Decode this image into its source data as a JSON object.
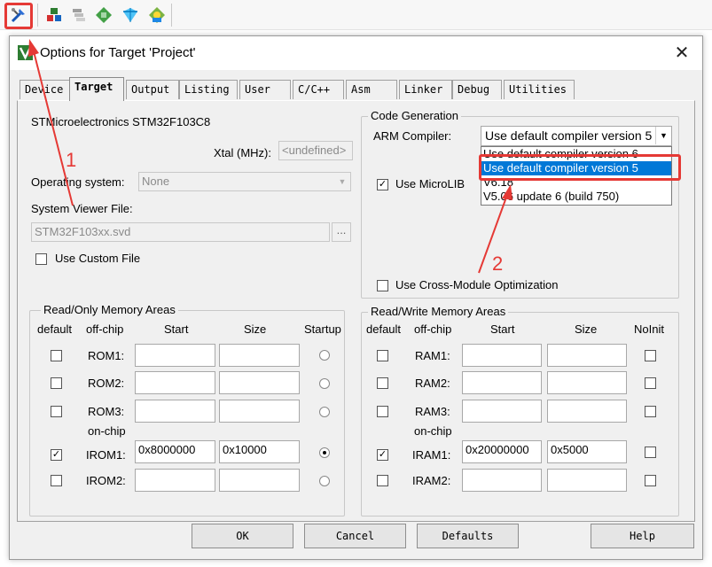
{
  "colors": {
    "annotation": "#e53935",
    "selection": "#0078d7",
    "dialog_bg": "#f0f0f0"
  },
  "toolbar": {
    "buttons": [
      {
        "icon": "target-options-icon",
        "highlighted": true
      },
      {
        "icon": "component-manage-icon"
      },
      {
        "icon": "multi-project-icon"
      },
      {
        "icon": "pack-installer-icon"
      },
      {
        "icon": "select-packs-icon"
      },
      {
        "icon": "software-components-icon"
      }
    ]
  },
  "dialog": {
    "title": "Options for Target 'Project'",
    "close_symbol": "✕",
    "tabs": [
      "Device",
      "Target",
      "Output",
      "Listing",
      "User",
      "C/C++",
      "Asm",
      "Linker",
      "Debug",
      "Utilities"
    ],
    "active_tab": "Target",
    "device_name": "STMicroelectronics STM32F103C8",
    "xtal_label": "Xtal (MHz):",
    "xtal_value": "<undefined>",
    "os_label": "Operating system:",
    "os_value": "None",
    "svd_label": "System Viewer File:",
    "svd_value": "STM32F103xx.svd",
    "browse_label": "...",
    "custom_file_label": "Use Custom File",
    "code_gen": {
      "title": "Code Generation",
      "compiler_label": "ARM Compiler:",
      "compiler_value": "Use default compiler version 5",
      "compiler_options": [
        "Use default compiler version 6",
        "Use default compiler version 5",
        "V6.18",
        "V5.06 update 6 (build 750)"
      ],
      "selected_option": 1,
      "microlib_label": "Use MicroLIB",
      "microlib_checked": true,
      "cross_module_label": "Use Cross-Module Optimization",
      "cross_module_checked": false
    },
    "rom": {
      "title": "Read/Only Memory Areas",
      "headers": [
        "default",
        "off-chip",
        "Start",
        "Size",
        "Startup"
      ],
      "on_chip_label": "on-chip",
      "rows": [
        {
          "label": "ROM1:",
          "checked": false,
          "start": "",
          "size": "",
          "startup": false
        },
        {
          "label": "ROM2:",
          "checked": false,
          "start": "",
          "size": "",
          "startup": false
        },
        {
          "label": "ROM3:",
          "checked": false,
          "start": "",
          "size": "",
          "startup": false
        },
        {
          "label": "IROM1:",
          "checked": true,
          "start": "0x8000000",
          "size": "0x10000",
          "startup": true
        },
        {
          "label": "IROM2:",
          "checked": false,
          "start": "",
          "size": "",
          "startup": false
        }
      ]
    },
    "ram": {
      "title": "Read/Write Memory Areas",
      "headers": [
        "default",
        "off-chip",
        "Start",
        "Size",
        "NoInit"
      ],
      "on_chip_label": "on-chip",
      "rows": [
        {
          "label": "RAM1:",
          "checked": false,
          "start": "",
          "size": "",
          "noinit": false
        },
        {
          "label": "RAM2:",
          "checked": false,
          "start": "",
          "size": "",
          "noinit": false
        },
        {
          "label": "RAM3:",
          "checked": false,
          "start": "",
          "size": "",
          "noinit": false
        },
        {
          "label": "IRAM1:",
          "checked": true,
          "start": "0x20000000",
          "size": "0x5000",
          "noinit": false
        },
        {
          "label": "IRAM2:",
          "checked": false,
          "start": "",
          "size": "",
          "noinit": false
        }
      ]
    },
    "buttons": {
      "ok": "OK",
      "cancel": "Cancel",
      "defaults": "Defaults",
      "help": "Help"
    }
  },
  "annotations": {
    "step1": "1",
    "step2": "2"
  }
}
